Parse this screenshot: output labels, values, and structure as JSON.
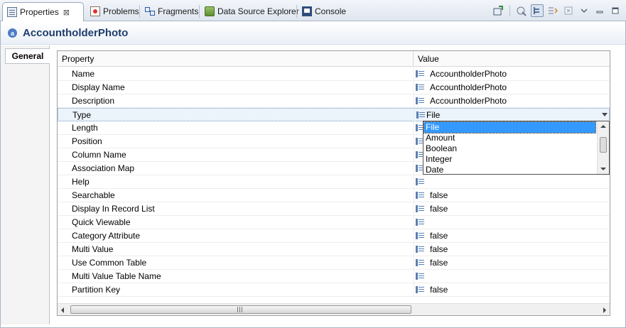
{
  "tabs": [
    {
      "label": "Properties",
      "icon": "properties-icon",
      "active": true,
      "close": "⊠"
    },
    {
      "label": "Problems",
      "icon": "problems-icon"
    },
    {
      "label": "Fragments",
      "icon": "fragments-icon"
    },
    {
      "label": "Data Source Explorer",
      "icon": "data-source-explorer-icon"
    },
    {
      "label": "Console",
      "icon": "console-icon"
    }
  ],
  "header": {
    "icon_letter": "a",
    "title": "AccountholderPhoto"
  },
  "sections": {
    "general": "General"
  },
  "table": {
    "col_property": "Property",
    "col_value": "Value",
    "rows": [
      {
        "name": "Name",
        "value": "AccountholderPhoto"
      },
      {
        "name": "Display Name",
        "value": "AccountholderPhoto"
      },
      {
        "name": "Description",
        "value": "AccountholderPhoto"
      },
      {
        "name": "Type",
        "value": "File"
      },
      {
        "name": "Length",
        "value": ""
      },
      {
        "name": "Position",
        "value": ""
      },
      {
        "name": "Column Name",
        "value": ""
      },
      {
        "name": "Association Map",
        "value": ""
      },
      {
        "name": "Help",
        "value": ""
      },
      {
        "name": "Searchable",
        "value": "false"
      },
      {
        "name": "Display In Record List",
        "value": "false"
      },
      {
        "name": "Quick Viewable",
        "value": ""
      },
      {
        "name": "Category Attribute",
        "value": "false"
      },
      {
        "name": "Multi Value",
        "value": "false"
      },
      {
        "name": "Use Common Table",
        "value": "false"
      },
      {
        "name": "Multi Value Table Name",
        "value": ""
      },
      {
        "name": "Partition Key",
        "value": "false"
      }
    ]
  },
  "dropdown": {
    "options": [
      "File",
      "Amount",
      "Boolean",
      "Integer",
      "Date"
    ],
    "selected": "File"
  },
  "colors": {
    "title_text": "#1f3d6b",
    "selection": "#3399ff"
  }
}
